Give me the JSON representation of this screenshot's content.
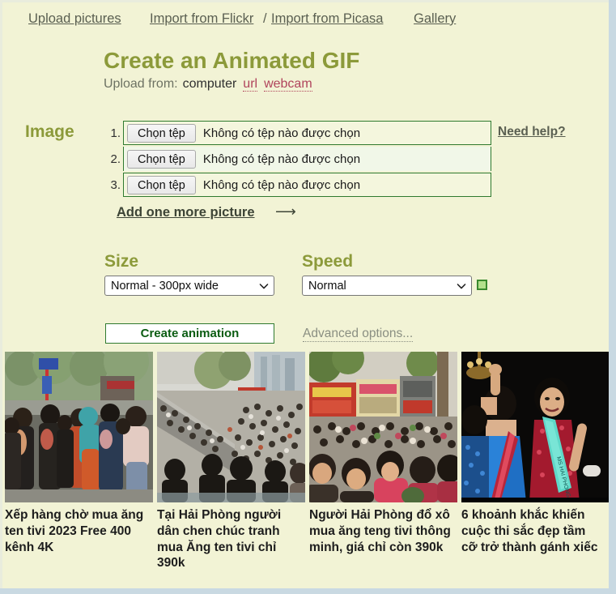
{
  "nav": {
    "upload_pictures": "Upload pictures",
    "import_flickr": "Import from Flickr",
    "separator": "/",
    "import_picasa": "Import from Picasa",
    "gallery": "Gallery"
  },
  "header": {
    "title": "Create an Animated GIF",
    "upload_from_label": "Upload from:",
    "upload_from_current": "computer",
    "upload_from_url": "url",
    "upload_from_webcam": "webcam"
  },
  "image_section": {
    "label": "Image",
    "need_help": "Need help?",
    "add_more": "Add one more picture",
    "add_more_arrow": "⟶",
    "rows": [
      {
        "number": "1.",
        "button": "Chọn tệp",
        "status": "Không có tệp nào được chọn"
      },
      {
        "number": "2.",
        "button": "Chọn tệp",
        "status": "Không có tệp nào được chọn"
      },
      {
        "number": "3.",
        "button": "Chọn tệp",
        "status": "Không có tệp nào được chọn"
      }
    ]
  },
  "options": {
    "size_label": "Size",
    "size_value": "Normal - 300px wide",
    "speed_label": "Speed",
    "speed_value": "Normal",
    "speed_indicator_color": "#3a8a2e"
  },
  "actions": {
    "create": "Create animation",
    "advanced": "Advanced options..."
  },
  "thumbnails": [
    {
      "caption": "Xếp hàng chờ mua ăng ten tivi 2023 Free 400 kênh 4K",
      "image_name": "crowd-queue-street-photo"
    },
    {
      "caption": "Tại Hải Phòng người dân chen chúc tranh mua Ăng ten tivi chỉ 390k",
      "image_name": "large-crowd-city-street-photo"
    },
    {
      "caption": "Người Hải Phòng đổ xô mua ăng teng tivi thông minh, giá chỉ còn 390k",
      "image_name": "street-crowd-shopfronts-photo"
    },
    {
      "caption": "6 khoảnh khắc khiến cuộc thi sắc đẹp tầm cỡ trở thành gánh xiếc",
      "image_name": "beauty-pageant-stage-photo"
    }
  ],
  "colors": {
    "page_background": "#f2f3d5",
    "accent_olive": "#8c9a3a",
    "link_maroon": "#b0445c",
    "border_green": "#2f7a2f",
    "chrome_blue": "#c9d9e2"
  }
}
